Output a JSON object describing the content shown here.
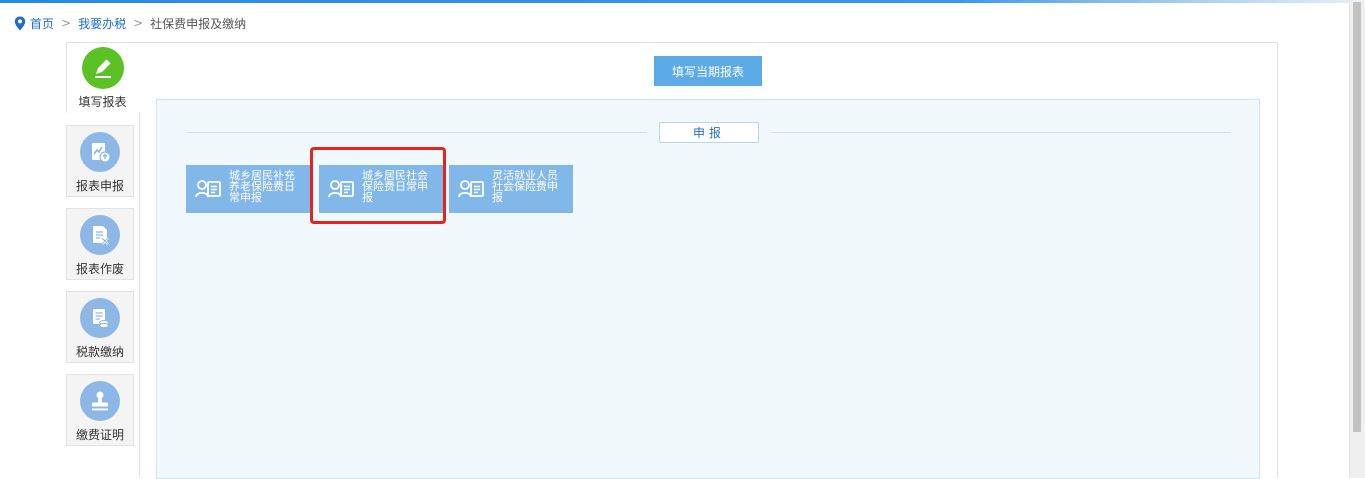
{
  "breadcrumb": {
    "home": "首页",
    "level2": "我要办税",
    "current": "社保费申报及缴纳",
    "separator": ">"
  },
  "sidebar": {
    "items": [
      {
        "label": "填写报表",
        "icon": "pencil-icon",
        "active": true
      },
      {
        "label": "报表申报",
        "icon": "report-submit-icon"
      },
      {
        "label": "报表作废",
        "icon": "report-void-icon"
      },
      {
        "label": "税款缴纳",
        "icon": "tax-payment-icon"
      },
      {
        "label": "缴费证明",
        "icon": "stamp-icon"
      }
    ]
  },
  "main": {
    "fill_button": "填写当期报表",
    "section_title": "申报",
    "tiles": [
      {
        "label": "城乡居民补充养老保险费日常申报",
        "icon": "id-card-icon"
      },
      {
        "label": "城乡居民社会保险费日常申报",
        "icon": "id-card-icon",
        "highlighted": true
      },
      {
        "label": "灵活就业人员社会保险费申报",
        "icon": "id-card-icon"
      }
    ]
  },
  "colors": {
    "active_icon_bg": "#5bc225",
    "icon_bg": "#8db8e6",
    "tile_bg": "#82b7ea",
    "button_bg": "#5daae8",
    "highlight": "#e8221c",
    "link": "#1e6ec8"
  }
}
